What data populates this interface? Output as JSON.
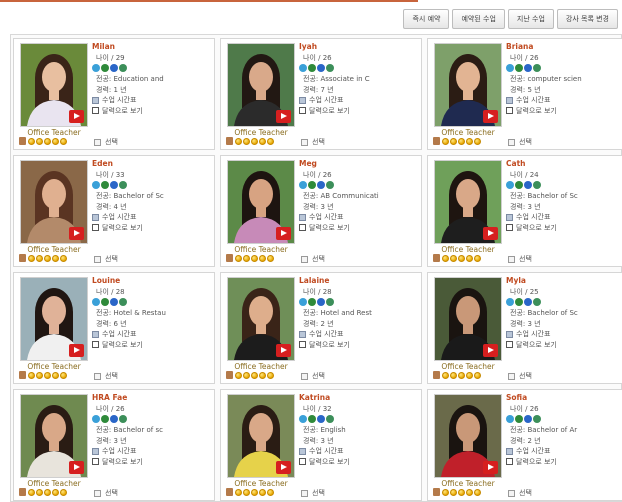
{
  "tabs": [
    "즉시 예약",
    "예약된 수업",
    "지난 수업",
    "강사 목록 변경"
  ],
  "labels": {
    "age_prefix": "나이 / ",
    "major_prefix": "전공: ",
    "exp_prefix": "경력: ",
    "schedule": "수업 시간표",
    "calendar": "달력으로 보기",
    "select": "선택",
    "job": "Office Teacher"
  },
  "colors": {
    "accent": "#c04a20",
    "play": "#d61f1f"
  },
  "teachers": [
    {
      "name": "Milan",
      "age": "29",
      "major": "Education and",
      "exp": "1 년",
      "photo": {
        "bg": "#6a8a3a",
        "hair": "#3a2418",
        "skin": "#e8bfa0",
        "shirt": "#e9e4f0"
      }
    },
    {
      "name": "Iyah",
      "age": "26",
      "major": "Associate in C",
      "exp": "7 년",
      "photo": {
        "bg": "#4f7a4a",
        "hair": "#221813",
        "skin": "#d9a98a",
        "shirt": "#2b2b2b"
      }
    },
    {
      "name": "Briana",
      "age": "26",
      "major": "computer scien",
      "exp": "5 년",
      "photo": {
        "bg": "#7ea06a",
        "hair": "#2b1c14",
        "skin": "#e2b493",
        "shirt": "#1f2a50"
      }
    },
    {
      "name": "Eden",
      "age": "33",
      "major": "Bachelor of Sc",
      "exp": "4 년",
      "photo": {
        "bg": "#8a6848",
        "hair": "#5a3422",
        "skin": "#e0b090",
        "shirt": "#b38a6a"
      }
    },
    {
      "name": "Meg",
      "age": "26",
      "major": "AB Communicati",
      "exp": "3 년",
      "photo": {
        "bg": "#5c8a48",
        "hair": "#1d1410",
        "skin": "#d7a382",
        "shirt": "#c78ab8"
      }
    },
    {
      "name": "Cath",
      "age": "24",
      "major": "Bachelor of Sc",
      "exp": "3 년",
      "photo": {
        "bg": "#6fa05a",
        "hair": "#1e1510",
        "skin": "#d9a888",
        "shirt": "#1e1e1e"
      }
    },
    {
      "name": "Louine",
      "age": "28",
      "major": "Hotel & Restau",
      "exp": "6 년",
      "photo": {
        "bg": "#9ab0b8",
        "hair": "#201612",
        "skin": "#e0b298",
        "shirt": "#f0f0f0"
      }
    },
    {
      "name": "Lalaine",
      "age": "28",
      "major": "Hotel and Rest",
      "exp": "2 년",
      "photo": {
        "bg": "#6f8f58",
        "hair": "#3a2418",
        "skin": "#deae8c",
        "shirt": "#1c1c1c"
      }
    },
    {
      "name": "Myla",
      "age": "25",
      "major": "Bachelor of Sc",
      "exp": "3 년",
      "photo": {
        "bg": "#4a5a38",
        "hair": "#1a1410",
        "skin": "#c99878",
        "shirt": "#1a1a1a"
      }
    },
    {
      "name": "HRA Fae",
      "age": "26",
      "major": "Bachelor of sc",
      "exp": "3 년",
      "photo": {
        "bg": "#6f8a50",
        "hair": "#2a1c14",
        "skin": "#d9a888",
        "shirt": "#e8e4dc"
      }
    },
    {
      "name": "Katrina",
      "age": "32",
      "major": "English",
      "exp": "3 년",
      "photo": {
        "bg": "#7a8a58",
        "hair": "#2a1c14",
        "skin": "#d9a888",
        "shirt": "#e6d24a"
      }
    },
    {
      "name": "Sofia",
      "age": "26",
      "major": "Bachelor of Ar",
      "exp": "2 년",
      "photo": {
        "bg": "#6a6a4a",
        "hair": "#1a1410",
        "skin": "#c99878",
        "shirt": "#c0202a"
      }
    }
  ]
}
